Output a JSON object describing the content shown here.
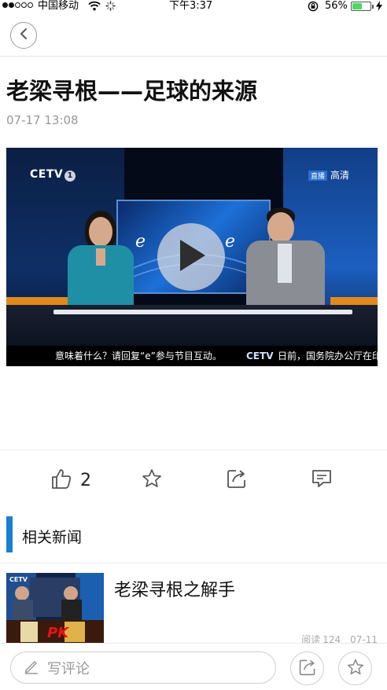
{
  "status_bar": {
    "carrier": "中国移动",
    "time": "下午3:37",
    "battery_percent": "56%",
    "battery_level": 0.56,
    "signal_bars_filled": 2,
    "signal_bars_total": 5
  },
  "nav": {
    "back_icon": "chevron-left-icon"
  },
  "article": {
    "title": "老梁寻根——足球的来源",
    "date": "07-17 13:08"
  },
  "video": {
    "channel_logo": "CETV",
    "channel_number": "1",
    "hd_badge": "高清",
    "hd_small_tag": "直播",
    "ticker_left": "意味着什么？请回复“e”参与节目互动。",
    "ticker_logo": "CETV",
    "ticker_right": "日前，国务院办公厅在印发"
  },
  "actions": {
    "like_count": "2",
    "icons": [
      "thumb-up-icon",
      "star-icon",
      "share-icon",
      "comment-icon"
    ]
  },
  "related": {
    "heading": "相关新闻",
    "items": [
      {
        "title": "老梁寻根之解手",
        "reads_label": "阅读",
        "reads": "124",
        "date": "07-11"
      }
    ]
  },
  "bottom_bar": {
    "comment_placeholder": "写评论"
  },
  "colors": {
    "accent": "#1a7fd4",
    "battery_green": "#4cd964",
    "text_muted": "#999999"
  }
}
